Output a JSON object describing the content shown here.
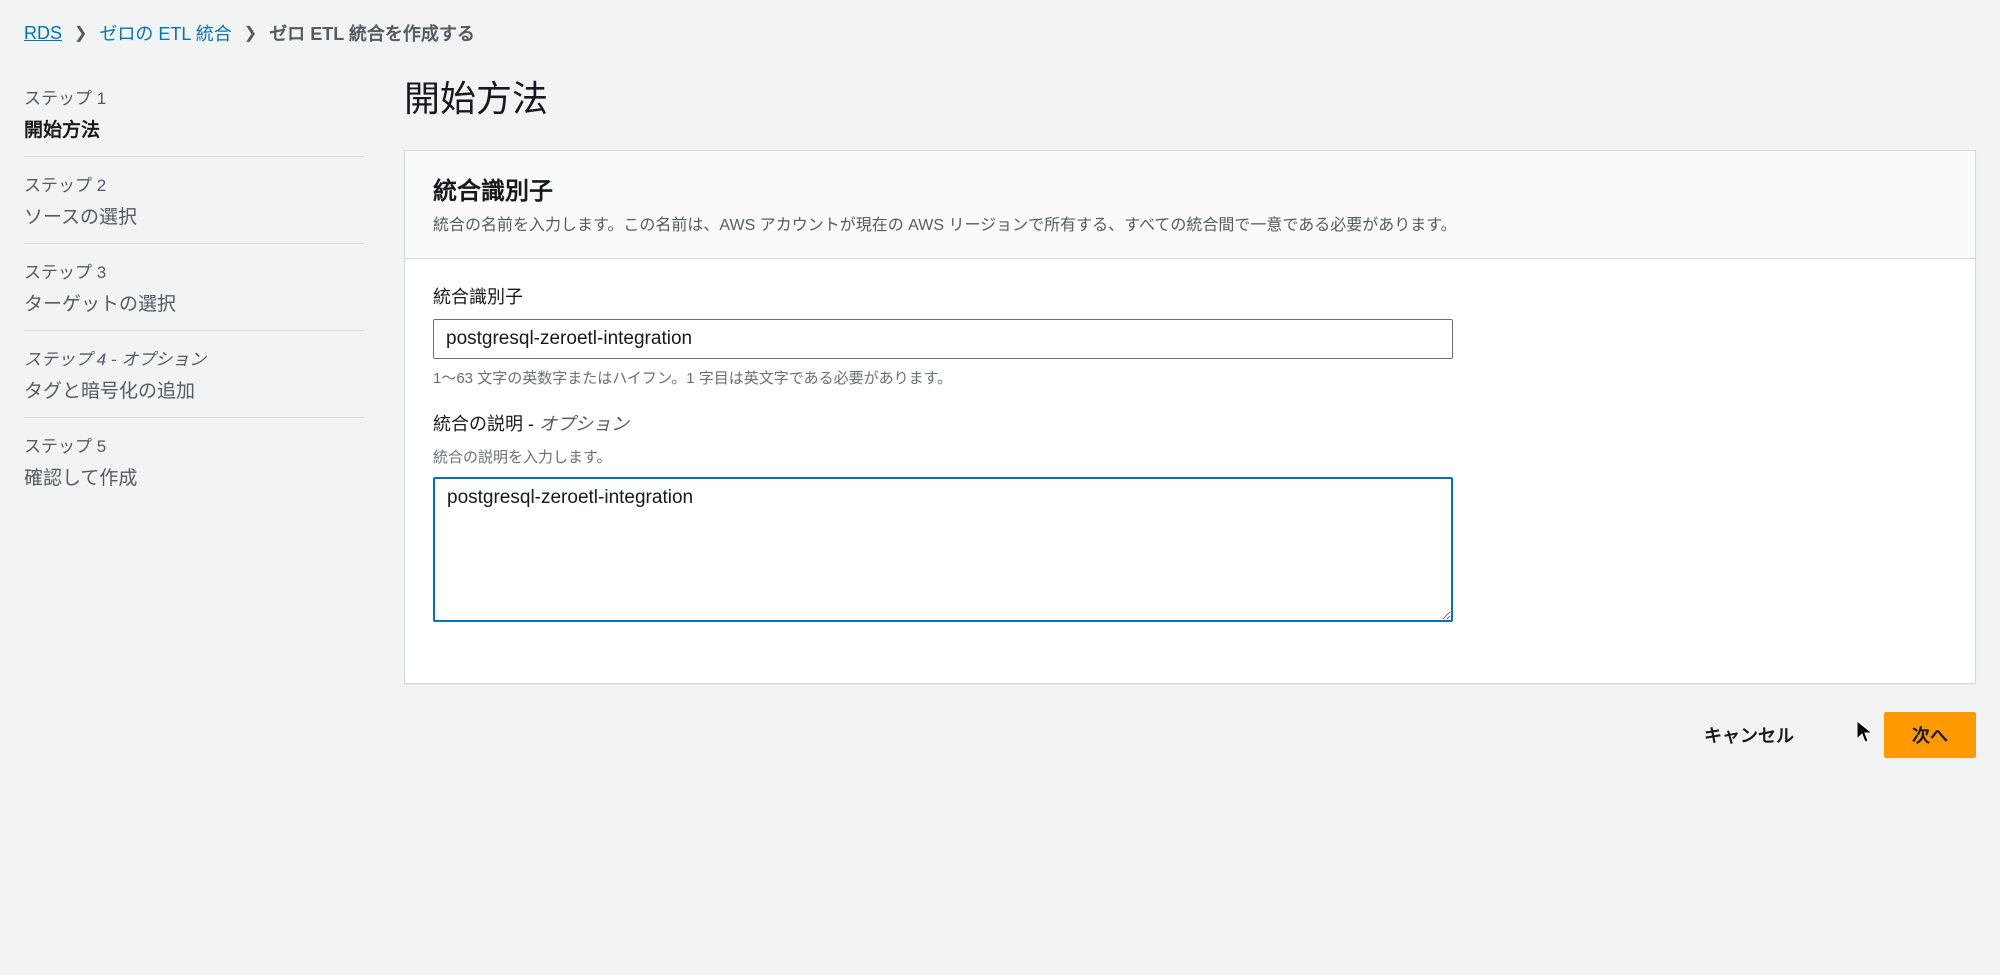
{
  "breadcrumb": {
    "root": "RDS",
    "parent": "ゼロの ETL 統合",
    "current": "ゼロ ETL 統合を作成する"
  },
  "sidebar": {
    "steps": [
      {
        "label": "ステップ 1",
        "title": "開始方法",
        "active": true
      },
      {
        "label": "ステップ 2",
        "title": "ソースの選択",
        "active": false
      },
      {
        "label": "ステップ 3",
        "title": "ターゲットの選択",
        "active": false
      },
      {
        "label": "ステップ 4 - オプション",
        "title": "タグと暗号化の追加",
        "active": false
      },
      {
        "label": "ステップ 5",
        "title": "確認して作成",
        "active": false
      }
    ]
  },
  "main": {
    "title": "開始方法",
    "panel": {
      "heading": "統合識別子",
      "description": "統合の名前を入力します。この名前は、AWS アカウントが現在の AWS リージョンで所有する、すべての統合間で一意である必要があります。"
    },
    "identifier": {
      "label": "統合識別子",
      "value": "postgresql-zeroetl-integration",
      "help": "1〜63 文字の英数字またはハイフン。1 字目は英文字である必要があります。"
    },
    "description": {
      "label": "統合の説明 - ",
      "optional": "オプション",
      "sublabel": "統合の説明を入力します。",
      "value": "postgresql-zeroetl-integration"
    }
  },
  "footer": {
    "cancel": "キャンセル",
    "next": "次へ"
  }
}
